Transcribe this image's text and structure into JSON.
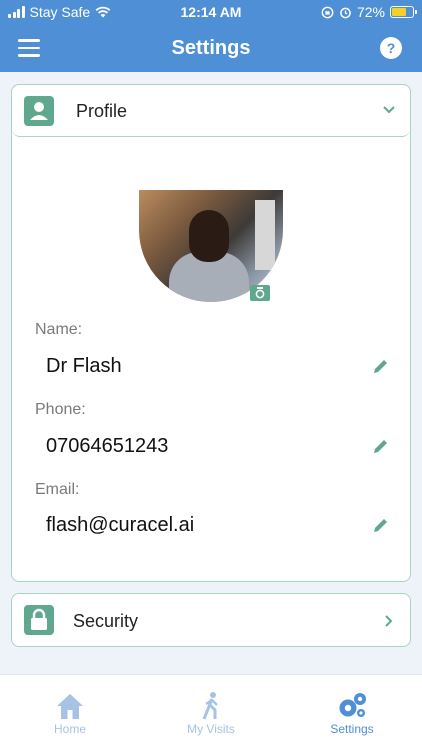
{
  "status_bar": {
    "carrier": "Stay Safe",
    "time": "12:14 AM",
    "battery": "72%"
  },
  "header": {
    "title": "Settings",
    "help_label": "?"
  },
  "profile_card": {
    "title": "Profile",
    "fields": [
      {
        "label": "Name:",
        "value": "Dr Flash"
      },
      {
        "label": "Phone:",
        "value": "07064651243"
      },
      {
        "label": "Email:",
        "value": "flash@curacel.ai"
      }
    ]
  },
  "security_card": {
    "title": "Security"
  },
  "tabs": [
    {
      "label": "Home",
      "icon": "home-icon",
      "active": false
    },
    {
      "label": "My Visits",
      "icon": "walking-person-icon",
      "active": false
    },
    {
      "label": "Settings",
      "icon": "gears-icon",
      "active": true
    }
  ],
  "colors": {
    "header_blue": "#4f8fd6",
    "accent_green": "#5fa88e",
    "card_border": "#a9d3c3"
  }
}
